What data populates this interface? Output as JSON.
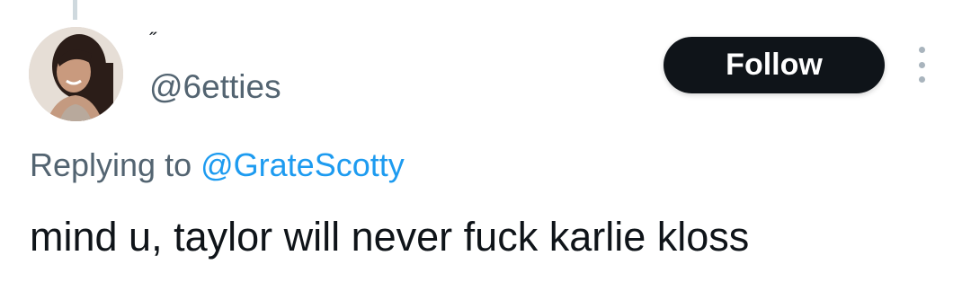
{
  "tweet": {
    "author": {
      "display_name": "˝",
      "handle": "@6etties",
      "avatar_icon": "profile-photo"
    },
    "follow_label": "Follow",
    "more_icon": "more-options-icon",
    "reply": {
      "prefix": "Replying to ",
      "target": "@GrateScotty"
    },
    "text": "mind u, taylor will never fuck karlie kloss"
  },
  "colors": {
    "text_primary": "#0f1419",
    "text_secondary": "#536471",
    "link": "#1d9bf0",
    "follow_bg": "#0f1419",
    "follow_text": "#ffffff",
    "thread_line": "#cfd9de"
  }
}
